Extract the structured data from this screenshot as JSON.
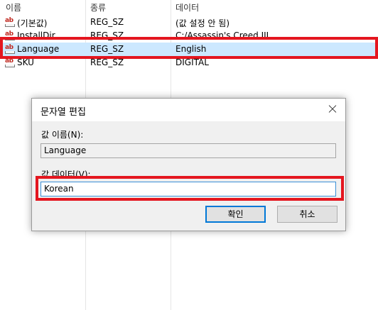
{
  "columns": {
    "name": "이름",
    "type": "종류",
    "data": "데이터"
  },
  "rows": [
    {
      "icon": "ab",
      "name": "(기본값)",
      "type": "REG_SZ",
      "data": "(값 설정 안 됨)"
    },
    {
      "icon": "ab",
      "name": "InstallDir",
      "type": "REG_SZ",
      "data": "C:/Assassin's Creed III"
    },
    {
      "icon": "ab",
      "name": "Language",
      "type": "REG_SZ",
      "data": "English"
    },
    {
      "icon": "ab",
      "name": "SKU",
      "type": "REG_SZ",
      "data": "DIGITAL"
    }
  ],
  "dialog": {
    "title": "문자열 편집",
    "value_name_label": "값 이름(N):",
    "value_name": "Language",
    "value_data_label": "값 데이터(V):",
    "value_data": "Korean",
    "ok_label": "확인",
    "cancel_label": "취소"
  },
  "colors": {
    "highlight": "#e4161f",
    "selection": "#cce8ff",
    "accent": "#0078d7"
  }
}
